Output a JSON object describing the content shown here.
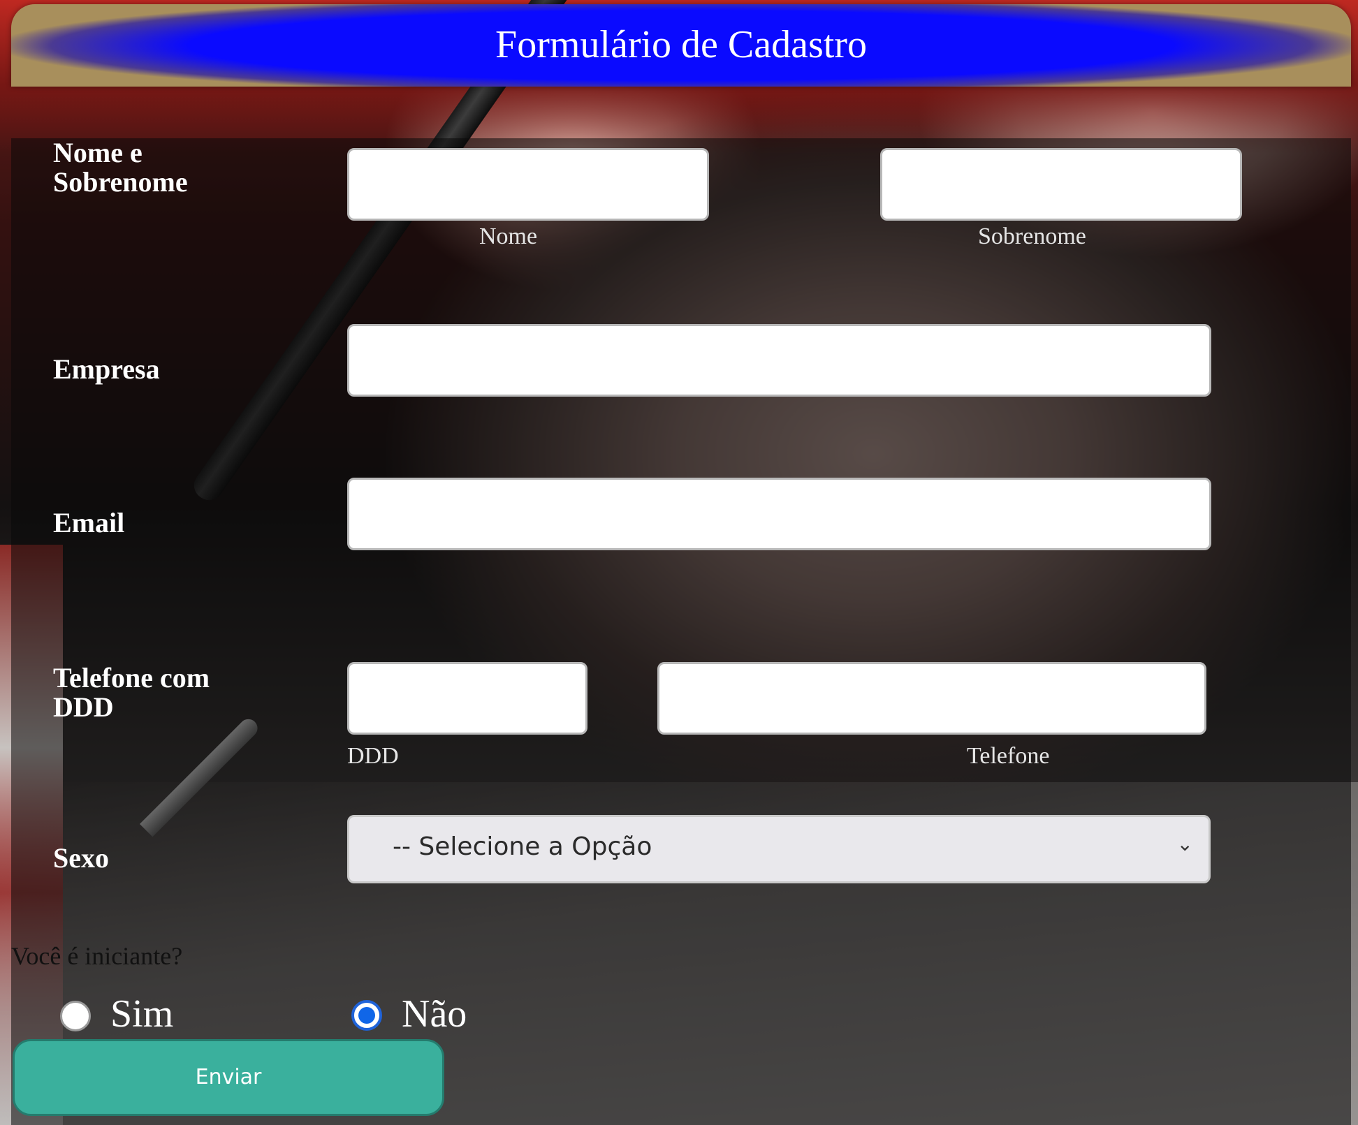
{
  "header": {
    "title": "Formulário de Cadastro"
  },
  "fields": {
    "nome_sobrenome": {
      "label_line1": "Nome e",
      "label_line2": "Sobrenome",
      "first_caption": "Nome",
      "last_caption": "Sobrenome",
      "first_value": "",
      "last_value": ""
    },
    "empresa": {
      "label": "Empresa",
      "value": ""
    },
    "email": {
      "label": "Email",
      "value": ""
    },
    "telefone": {
      "label_line1": "Telefone com",
      "label_line2": "DDD",
      "ddd_caption": "DDD",
      "phone_caption": "Telefone",
      "ddd_value": "",
      "phone_value": ""
    },
    "sexo": {
      "label": "Sexo",
      "selected": "-- Selecione a Opção"
    }
  },
  "iniciante": {
    "question": "Você é iniciante?",
    "options": [
      {
        "label": "Sim",
        "checked": false
      },
      {
        "label": "Não",
        "checked": true
      }
    ]
  },
  "submit": {
    "label": "Enviar"
  },
  "colors": {
    "header_blue": "#0a0aff",
    "submit_teal": "#3ab09d",
    "radio_blue": "#1066e8"
  }
}
